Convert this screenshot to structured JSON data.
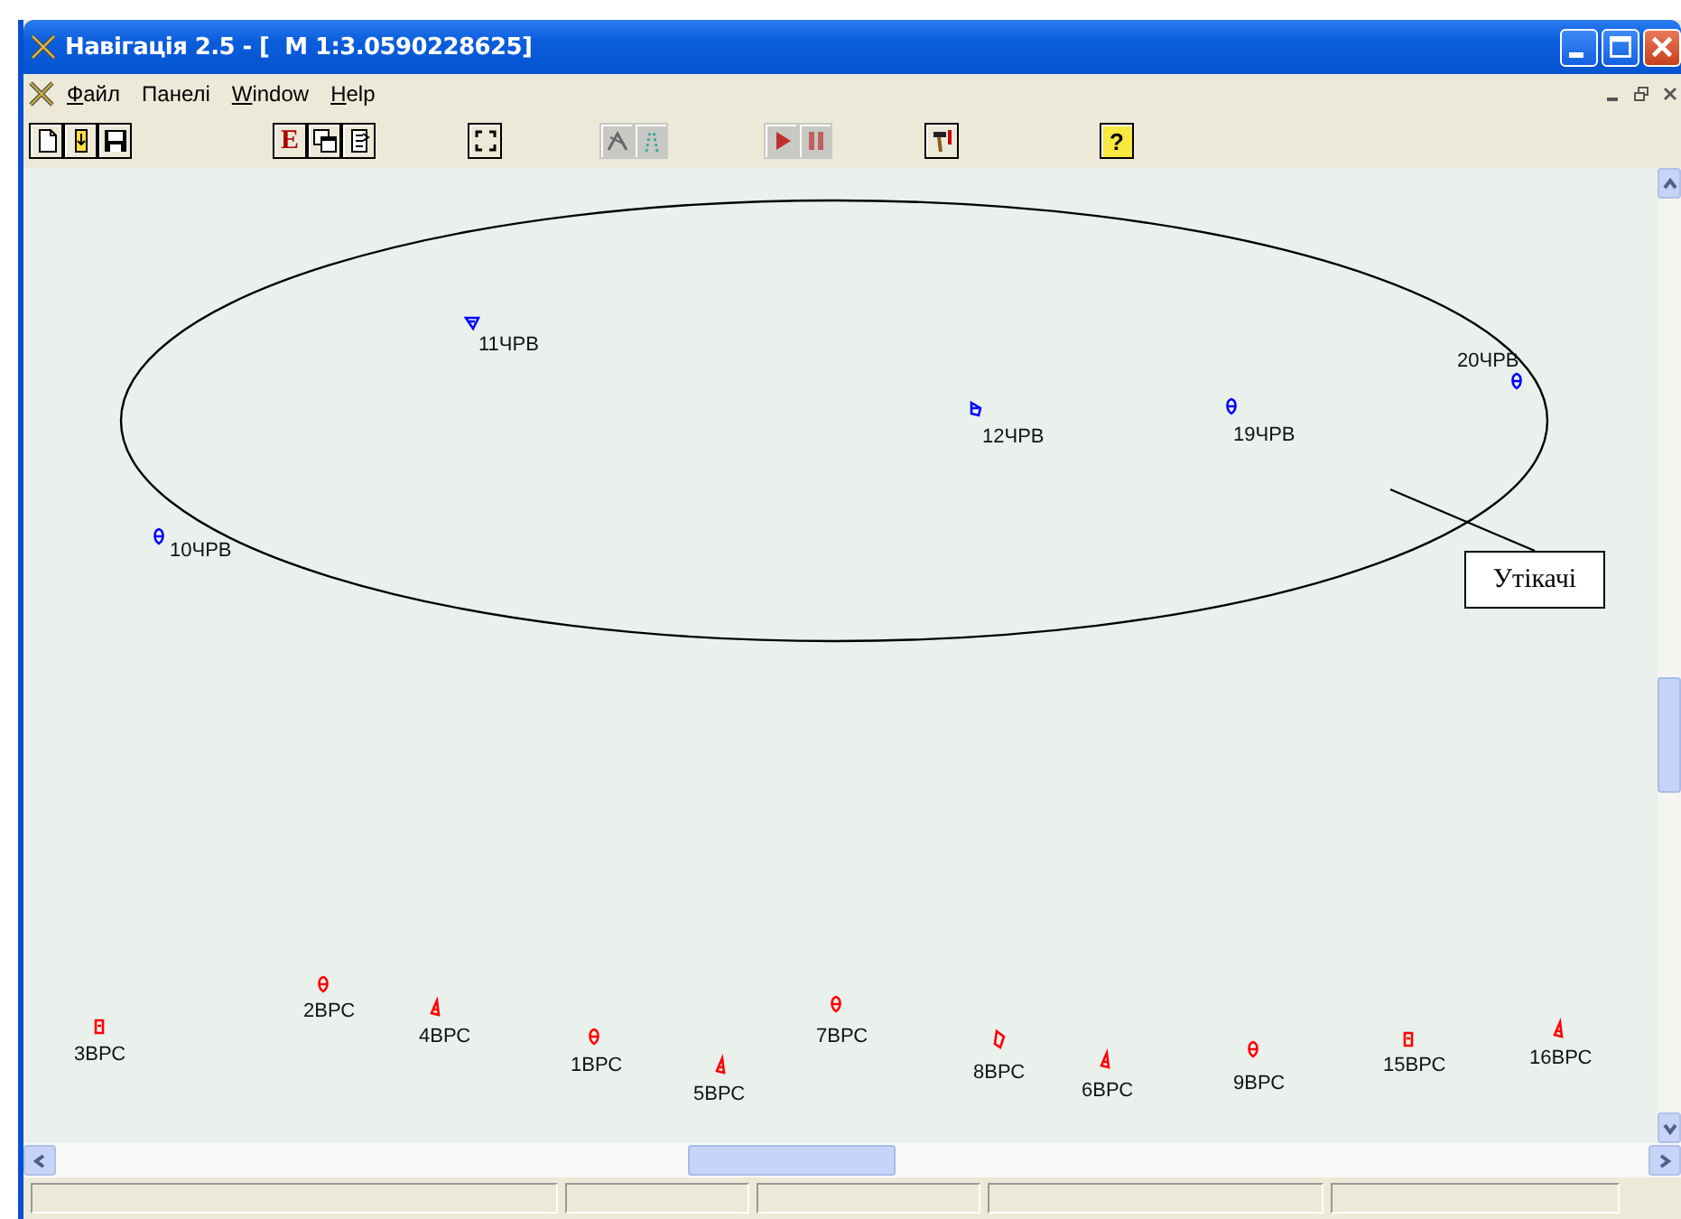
{
  "window": {
    "title": "Навігація 2.5 - [  M 1:3.0590228625]"
  },
  "menu": [
    {
      "label": "Файл",
      "underline_first": true
    },
    {
      "label": "Панелі",
      "underline_first": false
    },
    {
      "label": "Window",
      "underline_first": true
    },
    {
      "label": "Help",
      "underline_first": true
    }
  ],
  "toolbar": [
    [
      {
        "disabled": false
      },
      {
        "disabled": false
      },
      {
        "disabled": false
      }
    ],
    [
      {
        "text": "E",
        "disabled": false
      },
      {
        "disabled": false
      },
      {
        "disabled": false
      }
    ],
    [
      {
        "disabled": false
      }
    ],
    [
      {
        "disabled": true
      },
      {
        "disabled": true
      }
    ],
    [
      {
        "disabled": true
      },
      {
        "disabled": true
      }
    ],
    [
      {
        "disabled": false
      }
    ],
    [
      {
        "text": "?",
        "disabled": false
      }
    ]
  ],
  "map": {
    "group_label": "Утікачі",
    "vessels": [
      {
        "label": "11ЧРВ",
        "color": "#0000ff"
      },
      {
        "label": "10ЧРВ",
        "color": "#0000ff"
      },
      {
        "label": "12ЧРВ",
        "color": "#0000ff"
      },
      {
        "label": "19ЧРВ",
        "color": "#0000ff"
      },
      {
        "label": "20ЧРВ",
        "color": "#0000ff"
      },
      {
        "label": "3ВРС",
        "color": "#ff0000"
      },
      {
        "label": "2ВРС",
        "color": "#ff0000"
      },
      {
        "label": "4ВРС",
        "color": "#ff0000"
      },
      {
        "label": "1ВРС",
        "color": "#ff0000"
      },
      {
        "label": "5ВРС",
        "color": "#ff0000"
      },
      {
        "label": "7ВРС",
        "color": "#ff0000"
      },
      {
        "label": "8ВРС",
        "color": "#ff0000"
      },
      {
        "label": "6ВРС",
        "color": "#ff0000"
      },
      {
        "label": "9ВРС",
        "color": "#ff0000"
      },
      {
        "label": "15ВРС",
        "color": "#ff0000"
      },
      {
        "label": "16ВРС",
        "color": "#ff0000"
      }
    ]
  }
}
